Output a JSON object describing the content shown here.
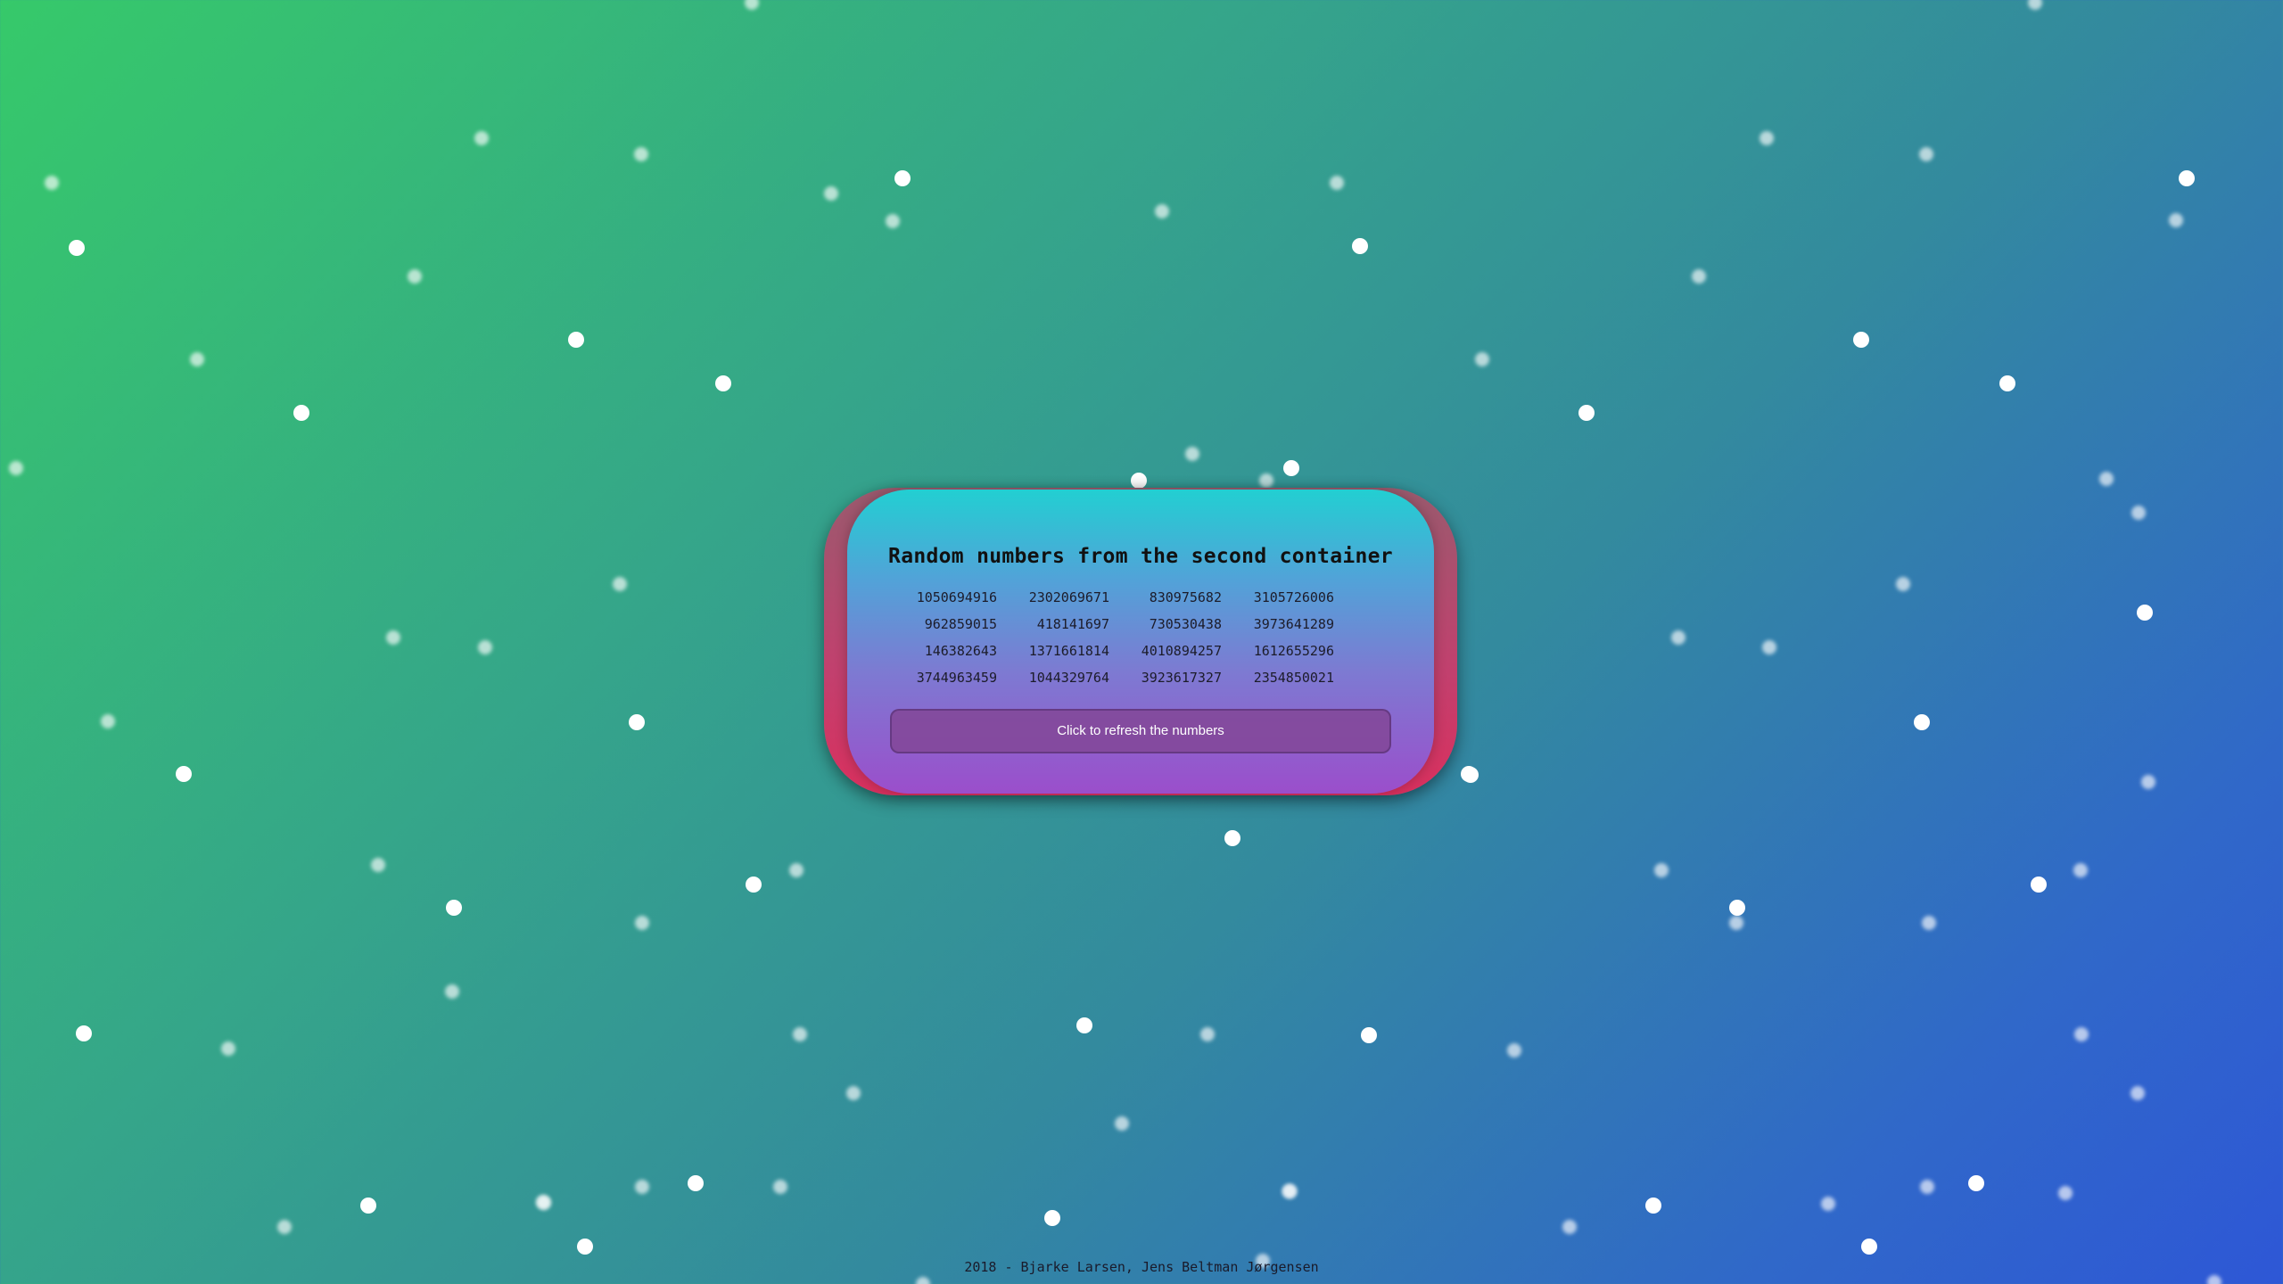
{
  "card": {
    "title": "Random numbers from the second container",
    "numbers": [
      "1050694916",
      "2302069671",
      "830975682",
      "3105726006",
      "962859015",
      "418141697",
      "730530438",
      "3973641289",
      "146382643",
      "1371661814",
      "4010894257",
      "1612655296",
      "3744963459",
      "1044329764",
      "3923617327",
      "2354850021"
    ],
    "refresh_label": "Click to refresh the numbers"
  },
  "footer": {
    "text": "2018 - Bjarke Larsen, Jens Beltman Jørgensen"
  },
  "colors": {
    "background_start": "#36c96a",
    "background_end": "#2e57d6",
    "card_top": "#22cfd2",
    "card_bottom": "#9b4ecb",
    "card_back": "#d9305e"
  }
}
